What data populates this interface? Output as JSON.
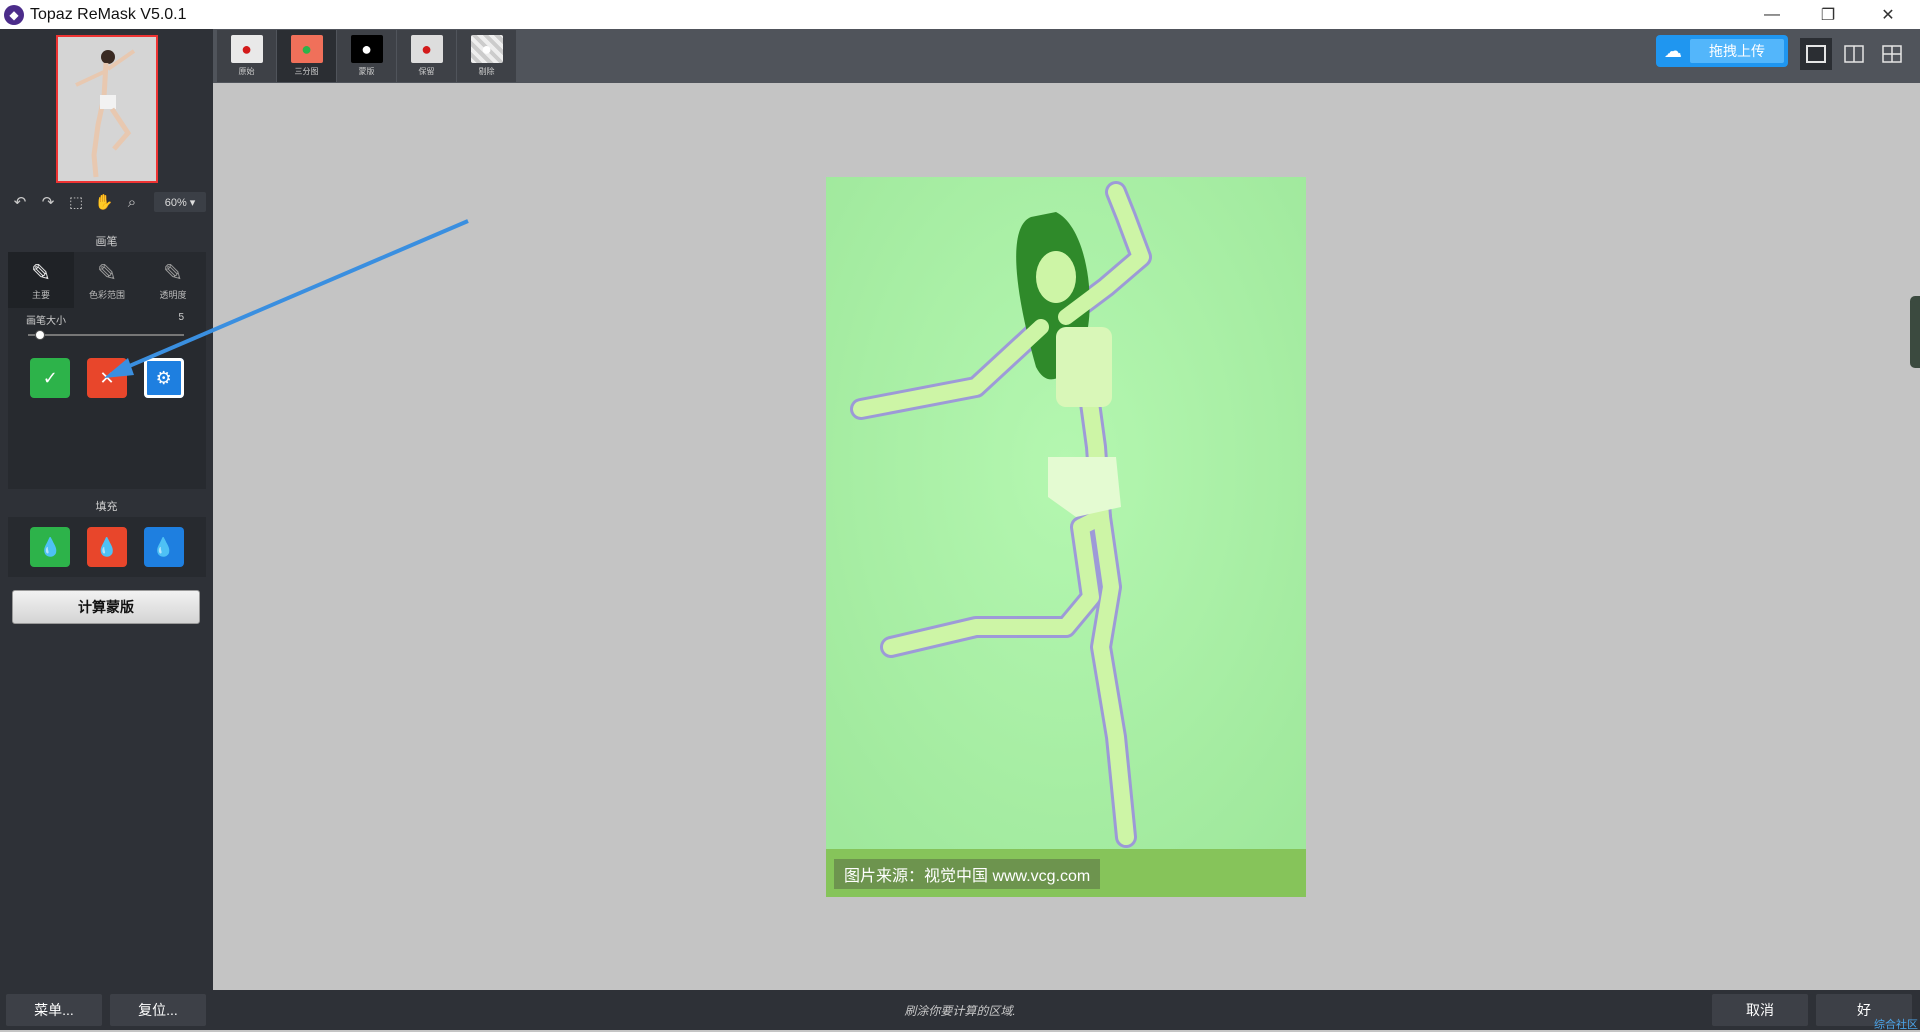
{
  "titlebar": {
    "title": "Topaz ReMask V5.0.1",
    "minimize": "—",
    "restore": "❐",
    "close": "✕"
  },
  "sidebar": {
    "zoom": "60% ▾",
    "brush_section_label": "画笔",
    "brush_types": [
      {
        "label": "主要",
        "icon": "brush-icon"
      },
      {
        "label": "色彩范围",
        "icon": "color-range-brush-icon"
      },
      {
        "label": "透明度",
        "icon": "transparency-brush-icon"
      }
    ],
    "brush_size_label": "画笔大小",
    "brush_size_value": "5",
    "brush_size_fraction": 0.07,
    "fill_section_label": "填充",
    "compute_button": "计算蒙版"
  },
  "topbar": {
    "view_tabs": [
      {
        "label": "原始"
      },
      {
        "label": "三分图"
      },
      {
        "label": "蒙版"
      },
      {
        "label": "保留"
      },
      {
        "label": "剔除"
      }
    ],
    "upload_label": "拖拽上传"
  },
  "canvas": {
    "watermark": "图片来源：视觉中国 www.vcg.com"
  },
  "bottombar": {
    "menu_button": "菜单...",
    "reset_button": "复位...",
    "hint": "刷涂你要计算的区域.",
    "cancel_button": "取消",
    "ok_button": "好",
    "corner_text": "综合社区"
  },
  "colors": {
    "keep": "#2db34a",
    "drop": "#e8462b",
    "compute": "#1e7fe0",
    "accent_blue": "#1f96f0"
  }
}
